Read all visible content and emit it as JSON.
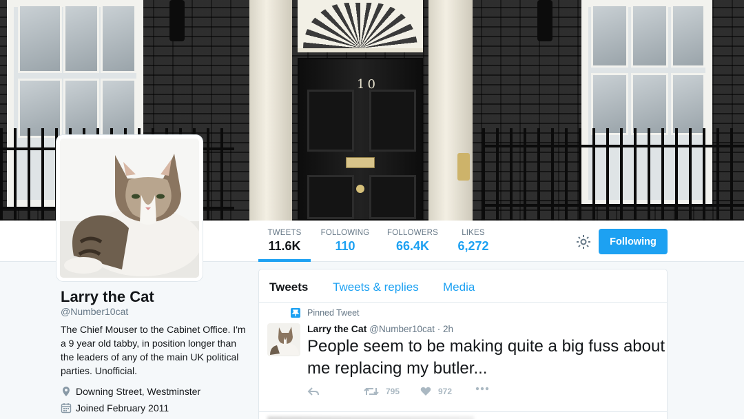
{
  "profile": {
    "name": "Larry the Cat",
    "handle": "@Number10cat",
    "bio": "The Chief Mouser to the Cabinet Office. I'm a 9 year old tabby, in position longer than the leaders of any of the main UK political parties. Unofficial.",
    "location": "Downing Street, Westminster",
    "joined": "Joined February 2011"
  },
  "header": {
    "door_number": "10"
  },
  "nav": {
    "stats": [
      {
        "label": "TWEETS",
        "value": "11.6K"
      },
      {
        "label": "FOLLOWING",
        "value": "110"
      },
      {
        "label": "FOLLOWERS",
        "value": "66.4K"
      },
      {
        "label": "LIKES",
        "value": "6,272"
      }
    ],
    "follow_button": "Following",
    "settings_icon": "gear-icon"
  },
  "timeline": {
    "tabs": [
      "Tweets",
      "Tweets & replies",
      "Media"
    ],
    "pinned_label": "Pinned Tweet",
    "tweet": {
      "author": "Larry the Cat",
      "meta": "@Number10cat · 2h",
      "text": "People seem to be making quite a big fuss about me replacing my butler...",
      "retweets": "795",
      "likes": "972"
    }
  },
  "colors": {
    "accent": "#1da1f2",
    "text": "#14171a",
    "muted": "#657786",
    "background": "#f5f8fa"
  }
}
